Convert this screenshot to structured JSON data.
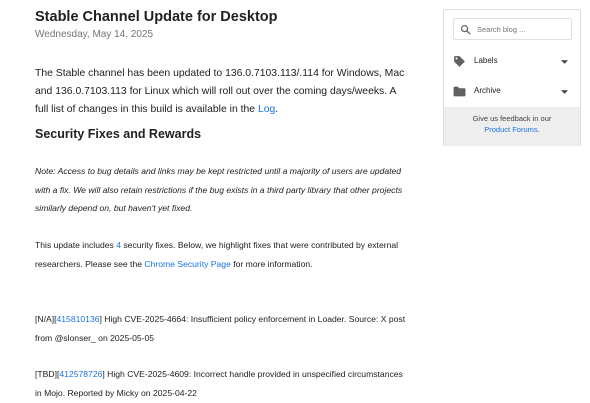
{
  "post": {
    "title": "Stable Channel Update for Desktop",
    "date": "Wednesday, May 14, 2025",
    "intro_text": " The Stable channel has been updated to 136.0.7103.113/.114 for Windows, Mac and 136.0.7103.113 for Linux which will roll out over the coming days/weeks. A full list of changes in this build is available in the ",
    "intro_link": "Log",
    "intro_end": ".",
    "section_heading": "Security Fixes and Rewards",
    "note": "Note: Access to bug details and links may be kept restricted until a majority of users are updated with a fix. We will also retain restrictions if the bug exists in a third party library that other projects similarly depend on, but haven't yet fixed.",
    "updates_pre": "This update includes ",
    "updates_count": "4",
    "updates_mid": " security fixes. Below, we highlight fixes that were contributed by external researchers. Please see the ",
    "updates_link": "Chrome Security Page",
    "updates_post": " for more information.",
    "entries": [
      {
        "prefix": "[N/A][",
        "bug_id": "415810136",
        "text": "] High CVE-2025-4664: Insufficient policy enforcement in Loader. Source: X post from @slonser_ on 2025-05-05"
      },
      {
        "prefix": "[TBD][",
        "bug_id": "412578726",
        "text": "] High CVE-2025-4609: Incorrect handle provided in unspecified circumstances in Mojo. Reported by Micky on 2025-04-22"
      }
    ]
  },
  "sidebar": {
    "search_placeholder": "Search blog ...",
    "labels": "Labels",
    "archive": "Archive",
    "feedback_text": "Give us feedback in our",
    "feedback_link": "Product Forums",
    "feedback_end": "."
  },
  "colors": {
    "link": "#1a73e8",
    "icon": "#616161",
    "feedback_bg": "#eeeeee"
  }
}
